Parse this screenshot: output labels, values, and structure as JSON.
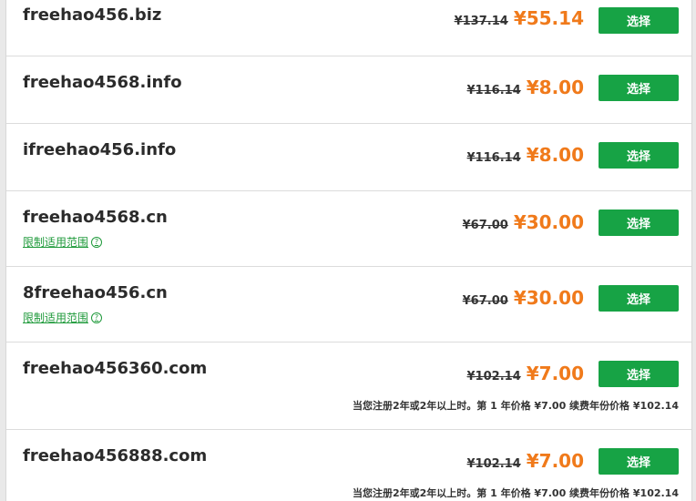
{
  "accent_color": "#17a345",
  "price_color": "#f07a1b",
  "select_label": "选择",
  "restrict_label": "限制适用范围",
  "restrict_icon": "question-circle-icon",
  "domains": [
    {
      "name": "freehao456.biz",
      "old_price": "¥137.14",
      "new_price": "¥55.14"
    },
    {
      "name": "freehao4568.info",
      "old_price": "¥116.14",
      "new_price": "¥8.00"
    },
    {
      "name": "ifreehao456.info",
      "old_price": "¥116.14",
      "new_price": "¥8.00"
    },
    {
      "name": "freehao4568.cn",
      "old_price": "¥67.00",
      "new_price": "¥30.00"
    },
    {
      "name": "8freehao456.cn",
      "old_price": "¥67.00",
      "new_price": "¥30.00"
    },
    {
      "name": "freehao456360.com",
      "old_price": "¥102.14",
      "new_price": "¥7.00",
      "note": "当您注册2年或2年以上时。第 1 年价格 ¥7.00 续费年份价格 ¥102.14"
    },
    {
      "name": "freehao456888.com",
      "old_price": "¥102.14",
      "new_price": "¥7.00",
      "note": "当您注册2年或2年以上时。第 1 年价格 ¥7.00 续费年份价格 ¥102.14"
    }
  ]
}
